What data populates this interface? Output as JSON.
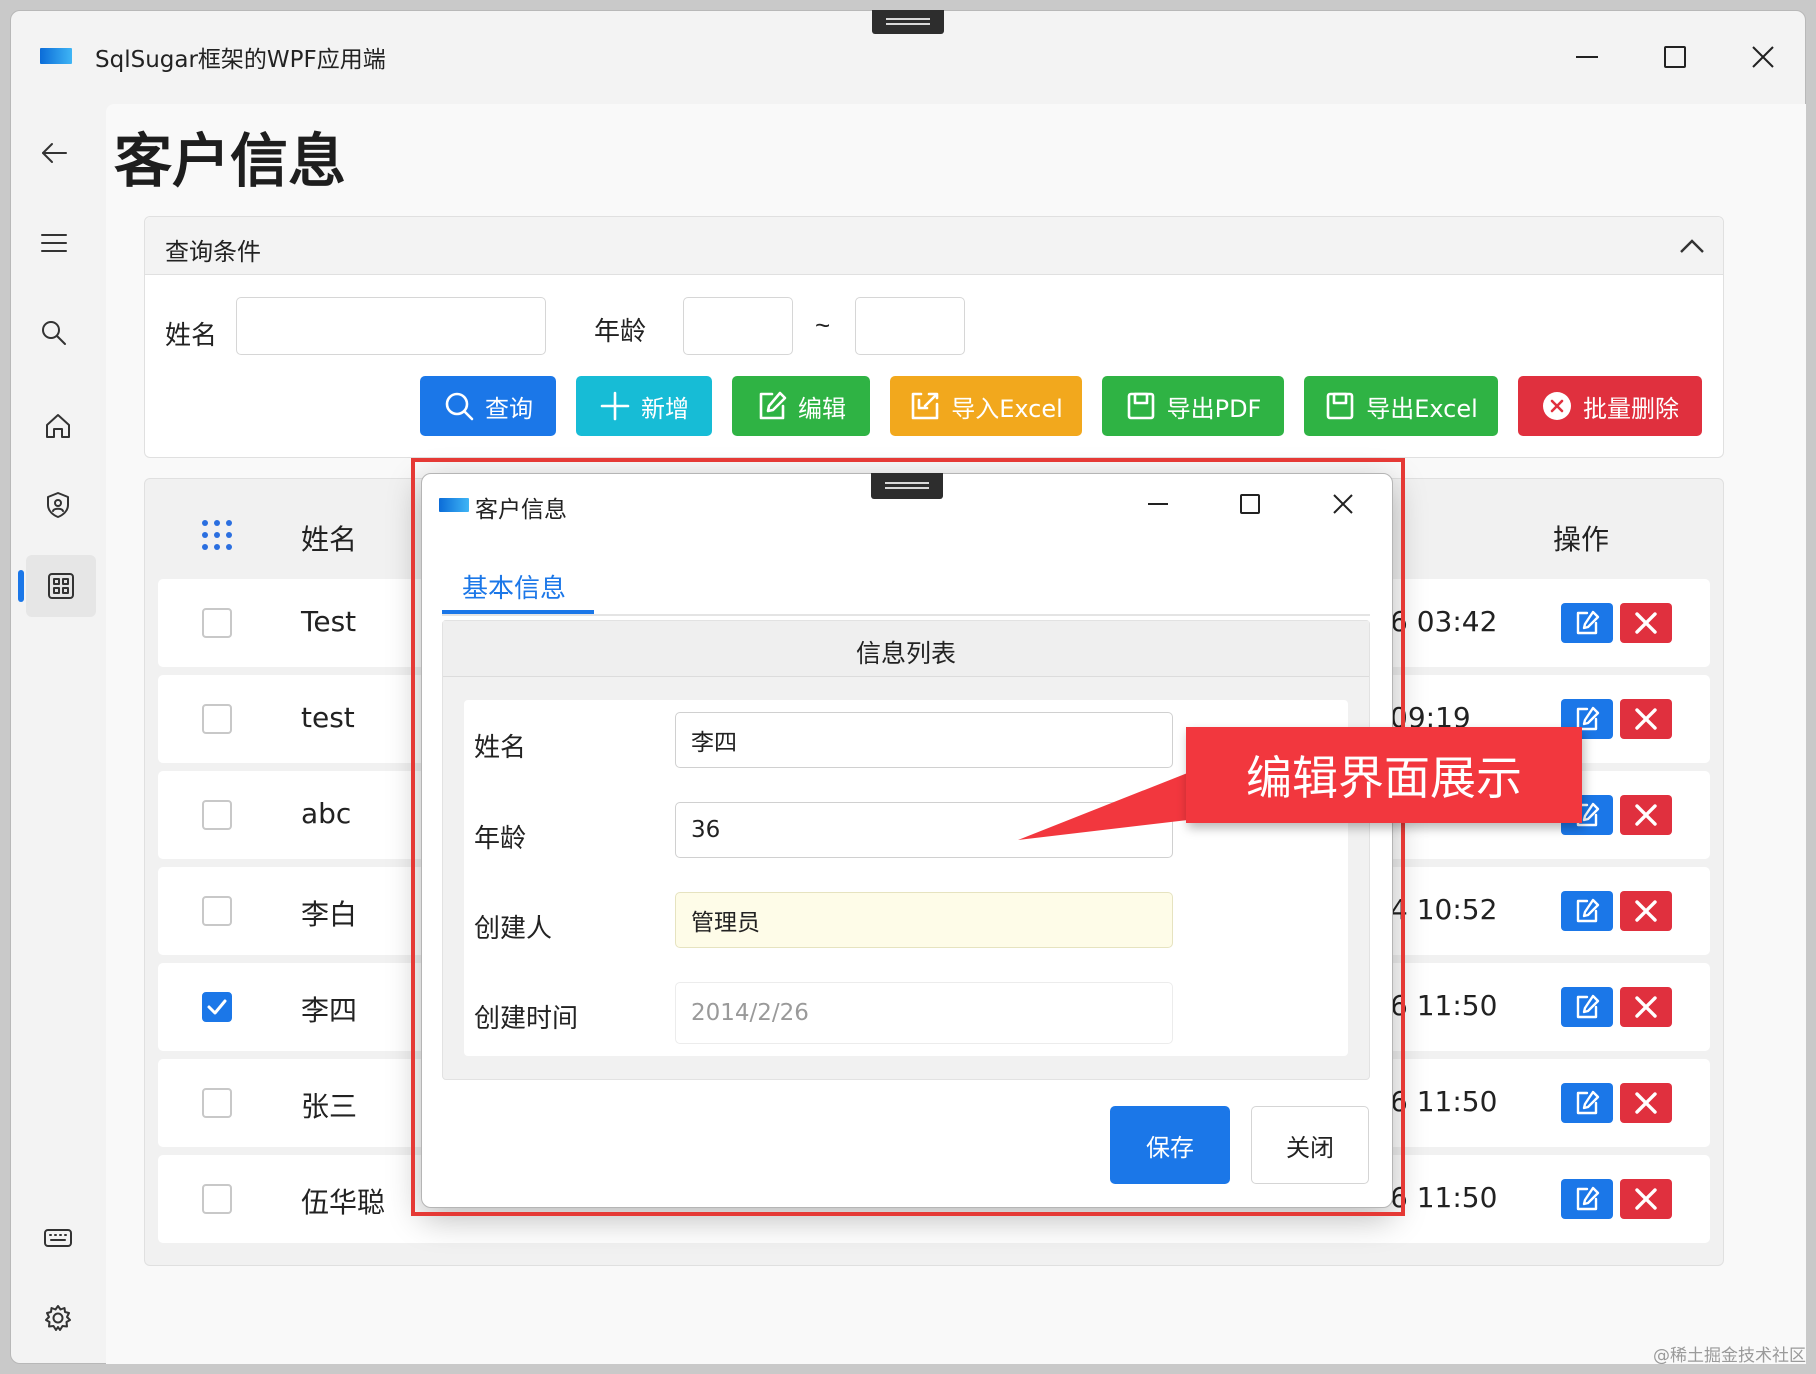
{
  "window": {
    "title": "SqlSugar框架的WPF应用端",
    "icons": [
      "minimize-icon",
      "maximize-icon",
      "close-icon"
    ]
  },
  "sidebar": {
    "items": [
      {
        "name": "back",
        "icon": "back-arrow-icon"
      },
      {
        "name": "menu",
        "icon": "hamburger-icon"
      },
      {
        "name": "search",
        "icon": "search-icon"
      },
      {
        "name": "home",
        "icon": "home-icon"
      },
      {
        "name": "security",
        "icon": "shield-icon"
      },
      {
        "name": "grid",
        "icon": "grid-icon",
        "active": true
      },
      {
        "name": "keyboard",
        "icon": "keyboard-icon"
      },
      {
        "name": "settings",
        "icon": "gear-icon"
      }
    ]
  },
  "page": {
    "title": "客户信息"
  },
  "query": {
    "header": "查询条件",
    "name_label": "姓名",
    "name_value": "",
    "age_label": "年龄",
    "age_from": "",
    "age_sep": "~",
    "age_to": ""
  },
  "toolbar": {
    "buttons": [
      {
        "label": "查询",
        "icon": "search-icon",
        "color": "#1b77e8"
      },
      {
        "label": "新增",
        "icon": "plus-icon",
        "color": "#17bcd6"
      },
      {
        "label": "编辑",
        "icon": "edit-icon",
        "color": "#2fb344"
      },
      {
        "label": "导入Excel",
        "icon": "import-icon",
        "color": "#f2a81d"
      },
      {
        "label": "导出PDF",
        "icon": "save-icon",
        "color": "#2fb344"
      },
      {
        "label": "导出Excel",
        "icon": "save-icon",
        "color": "#2fb344"
      },
      {
        "label": "批量删除",
        "icon": "close-circle-icon",
        "color": "#e0303e"
      }
    ]
  },
  "table": {
    "headers": {
      "name": "姓名",
      "actions": "操作"
    },
    "rows": [
      {
        "name": "Test",
        "time_visible": "6 03:42",
        "checked": false
      },
      {
        "name": "test",
        "time_visible": "09:19",
        "checked": false
      },
      {
        "name": "abc",
        "time_visible": "",
        "checked": false
      },
      {
        "name": "李白",
        "time_visible": "4 10:52",
        "checked": false
      },
      {
        "name": "李四",
        "time_visible": "6 11:50",
        "checked": true
      },
      {
        "name": "张三",
        "time_visible": "6 11:50",
        "checked": false
      },
      {
        "name": "伍华聪",
        "time_visible": "6 11:50",
        "checked": false
      }
    ],
    "colors": {
      "edit": "#1b77e8",
      "delete": "#e0303e"
    }
  },
  "dialog": {
    "title": "客户信息",
    "tab": "基本信息",
    "section": "信息列表",
    "fields": [
      {
        "label": "姓名",
        "value": "李四"
      },
      {
        "label": "年龄",
        "value": "36"
      },
      {
        "label": "创建人",
        "value": "管理员"
      },
      {
        "label": "创建时间",
        "value": "2014/2/26"
      }
    ],
    "save": "保存",
    "close": "关闭"
  },
  "annotation": {
    "text": "编辑界面展示",
    "color": "#f2373e"
  },
  "watermark": "@稀土掘金技术社区"
}
